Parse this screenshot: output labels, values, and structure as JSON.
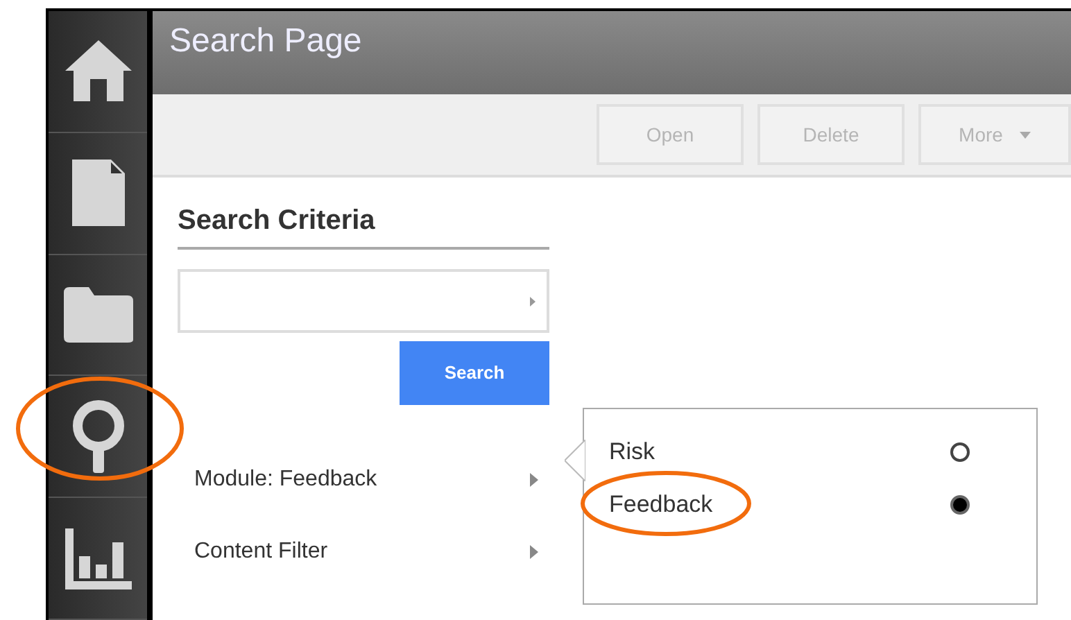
{
  "sidebar": {
    "items": [
      {
        "kind": "home",
        "highlighted": false
      },
      {
        "kind": "document",
        "highlighted": false
      },
      {
        "kind": "folder",
        "highlighted": false
      },
      {
        "kind": "search",
        "highlighted": true
      },
      {
        "kind": "chart",
        "highlighted": false
      }
    ]
  },
  "header": {
    "title": "Search Page"
  },
  "toolbar": {
    "buttons": [
      {
        "label": "Open",
        "disabled": true,
        "kind": "plain"
      },
      {
        "label": "Delete",
        "disabled": true,
        "kind": "plain"
      },
      {
        "label": "More",
        "disabled": true,
        "kind": "dropdown"
      }
    ]
  },
  "search_criteria": {
    "title": "Search Criteria",
    "search_button": "Search",
    "filters": [
      {
        "label": "Module: Feedback"
      },
      {
        "label": "Content Filter"
      }
    ]
  },
  "module_options": [
    {
      "label": "Risk",
      "selected": false,
      "highlighted": false
    },
    {
      "label": "Feedback",
      "selected": true,
      "highlighted": true
    }
  ]
}
